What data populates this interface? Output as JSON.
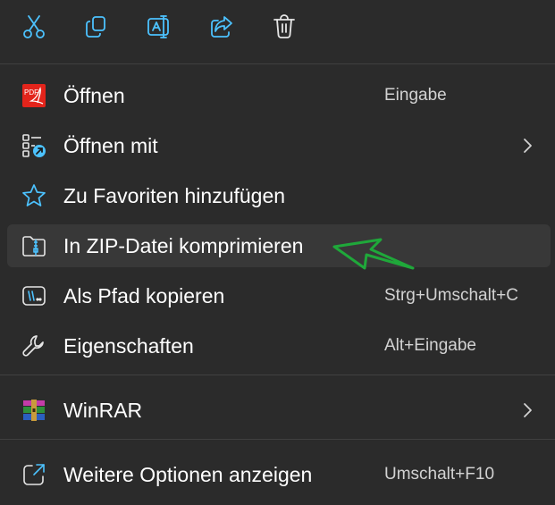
{
  "quickbar": {
    "actions": [
      {
        "name": "cut",
        "icon": "scissors-icon"
      },
      {
        "name": "copy",
        "icon": "copy-icon"
      },
      {
        "name": "rename",
        "icon": "rename-icon"
      },
      {
        "name": "share",
        "icon": "share-icon"
      },
      {
        "name": "delete",
        "icon": "trash-icon"
      }
    ]
  },
  "items": [
    {
      "label": "Öffnen",
      "shortcut": "Eingabe",
      "icon": "pdf-icon"
    },
    {
      "label": "Öffnen mit",
      "shortcut": "",
      "icon": "open-with-icon",
      "submenu": true
    },
    {
      "label": "Zu Favoriten hinzufügen",
      "shortcut": "",
      "icon": "star-icon"
    },
    {
      "label": "In ZIP-Datei komprimieren",
      "shortcut": "",
      "icon": "zip-folder-icon",
      "hovered": true
    },
    {
      "label": "Als Pfad kopieren",
      "shortcut": "Strg+Umschalt+C",
      "icon": "copy-path-icon"
    },
    {
      "label": "Eigenschaften",
      "shortcut": "Alt+Eingabe",
      "icon": "wrench-icon"
    },
    {
      "label": "WinRAR",
      "shortcut": "",
      "icon": "winrar-icon",
      "submenu": true
    },
    {
      "label": "Weitere Optionen anzeigen",
      "shortcut": "Umschalt+F10",
      "icon": "more-options-icon"
    }
  ],
  "colors": {
    "background": "#2b2b2b",
    "hover": "#383838",
    "accent": "#4cc2ff",
    "annotation_arrow": "#1fa83a"
  }
}
